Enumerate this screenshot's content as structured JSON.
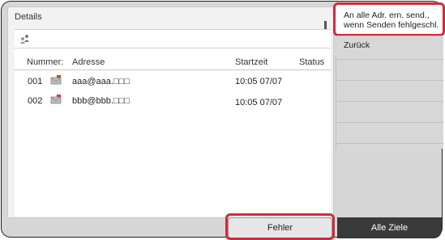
{
  "panel": {
    "title": "Details"
  },
  "table": {
    "headers": {
      "number": "Nummer:",
      "address": "Adresse",
      "start": "Startzeit",
      "status": "Status"
    },
    "rows": [
      {
        "number": "001",
        "address": "aaa@aaa.□□□",
        "start": "10:05 07/07",
        "status": ""
      },
      {
        "number": "002",
        "address": "bbb@bbb.□□□",
        "start": "10:05 07/07",
        "status": ""
      }
    ]
  },
  "menu": {
    "item1_line1": "An alle Adr. ern. send.,",
    "item1_line2": "wenn Senden fehlgeschl.",
    "item2": "Zurück"
  },
  "buttons": {
    "error": "Fehler",
    "all_targets": "Alle Ziele"
  },
  "colors": {
    "highlight": "#d32a3a",
    "dark_button": "#3a3a3a"
  }
}
